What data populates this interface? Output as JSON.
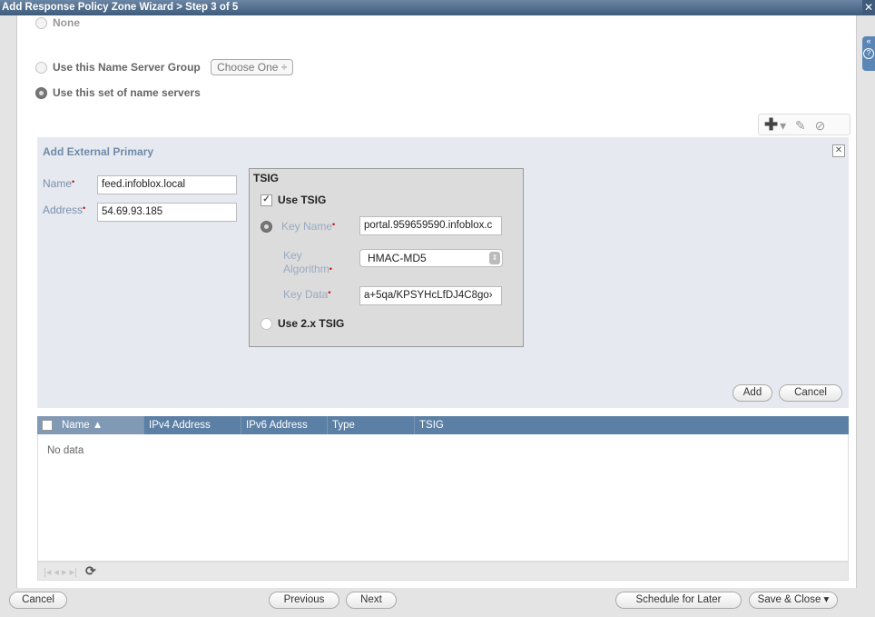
{
  "window": {
    "title": "Add Response Policy Zone Wizard > Step 3 of 5",
    "close_glyph": "✕"
  },
  "side_tab": {
    "collapse_glyph": "«",
    "help_glyph": "?"
  },
  "options": {
    "none_label": "None",
    "ns_group_label": "Use this Name Server Group",
    "ns_group_select": "Choose One ÷",
    "set_label": "Use this set of name servers"
  },
  "toolbar": {
    "add_glyph": "✚",
    "dropdown_glyph": "▾",
    "edit_glyph": "✎",
    "delete_glyph": "⊘"
  },
  "external_primary": {
    "title": "Add External Primary",
    "close_glyph": "✕",
    "name_label": "Name",
    "name_value": "feed.infoblox.local",
    "address_label": "Address",
    "address_value": "54.69.93.185",
    "required_mark": "•"
  },
  "tsig": {
    "title": "TSIG",
    "use_tsig_label": "Use TSIG",
    "use_tsig_checked": true,
    "key_name_label": "Key Name",
    "key_name_value": "portal.959659590.infoblox.c",
    "key_algorithm_label_1": "Key",
    "key_algorithm_label_2": "Algorithm",
    "key_algorithm_value": "HMAC-MD5",
    "key_data_label": "Key Data",
    "key_data_value": "a+5qa/KPSYHcLfDJ4C8go›",
    "use_2x_label": "Use 2.x TSIG"
  },
  "form_buttons": {
    "add": "Add",
    "cancel": "Cancel"
  },
  "grid": {
    "columns": [
      "Name ▲",
      "IPv4 Address",
      "IPv6 Address",
      "Type",
      "TSIG"
    ],
    "empty_text": "No data",
    "pager_glyphs": "|◂ ◂ ▸ ▸|",
    "refresh_glyph": "⟳"
  },
  "footer": {
    "cancel": "Cancel",
    "previous": "Previous",
    "next": "Next",
    "schedule": "Schedule for Later",
    "save_close": "Save & Close ▾"
  }
}
